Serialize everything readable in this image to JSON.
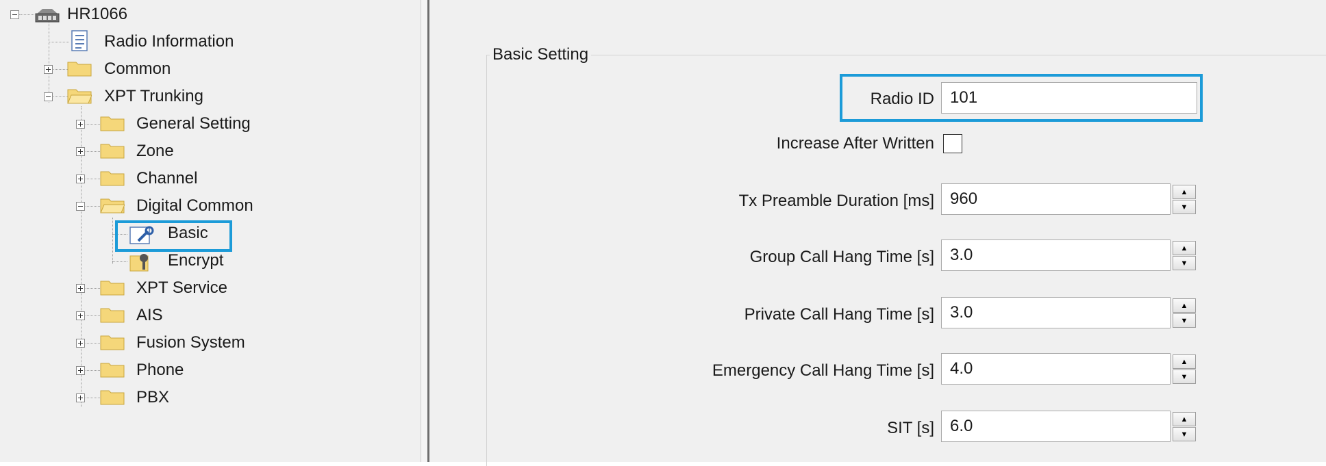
{
  "tree": {
    "root": "HR1066",
    "items": [
      {
        "label": "Radio Information"
      },
      {
        "label": "Common"
      },
      {
        "label": "XPT Trunking"
      },
      {
        "label": "General Setting"
      },
      {
        "label": "Zone"
      },
      {
        "label": "Channel"
      },
      {
        "label": "Digital Common"
      },
      {
        "label": "Basic"
      },
      {
        "label": "Encrypt"
      },
      {
        "label": "XPT Service"
      },
      {
        "label": "AIS"
      },
      {
        "label": "Fusion System"
      },
      {
        "label": "Phone"
      },
      {
        "label": "PBX"
      }
    ]
  },
  "panel": {
    "group_title": "Basic Setting",
    "radio_id": {
      "label": "Radio ID",
      "value": "101"
    },
    "increase_after_written": {
      "label": "Increase After Written",
      "checked": false
    },
    "tx_preamble": {
      "label": "Tx Preamble Duration [ms]",
      "value": "960"
    },
    "group_call_hang": {
      "label": "Group Call Hang Time [s]",
      "value": "3.0"
    },
    "private_call_hang": {
      "label": "Private Call Hang Time [s]",
      "value": "3.0"
    },
    "emergency_call_hang": {
      "label": "Emergency Call Hang Time [s]",
      "value": "4.0"
    },
    "sit": {
      "label": "SIT [s]",
      "value": "6.0"
    }
  },
  "colors": {
    "highlight": "#1c9bd8",
    "folder": "#f5d77a"
  }
}
